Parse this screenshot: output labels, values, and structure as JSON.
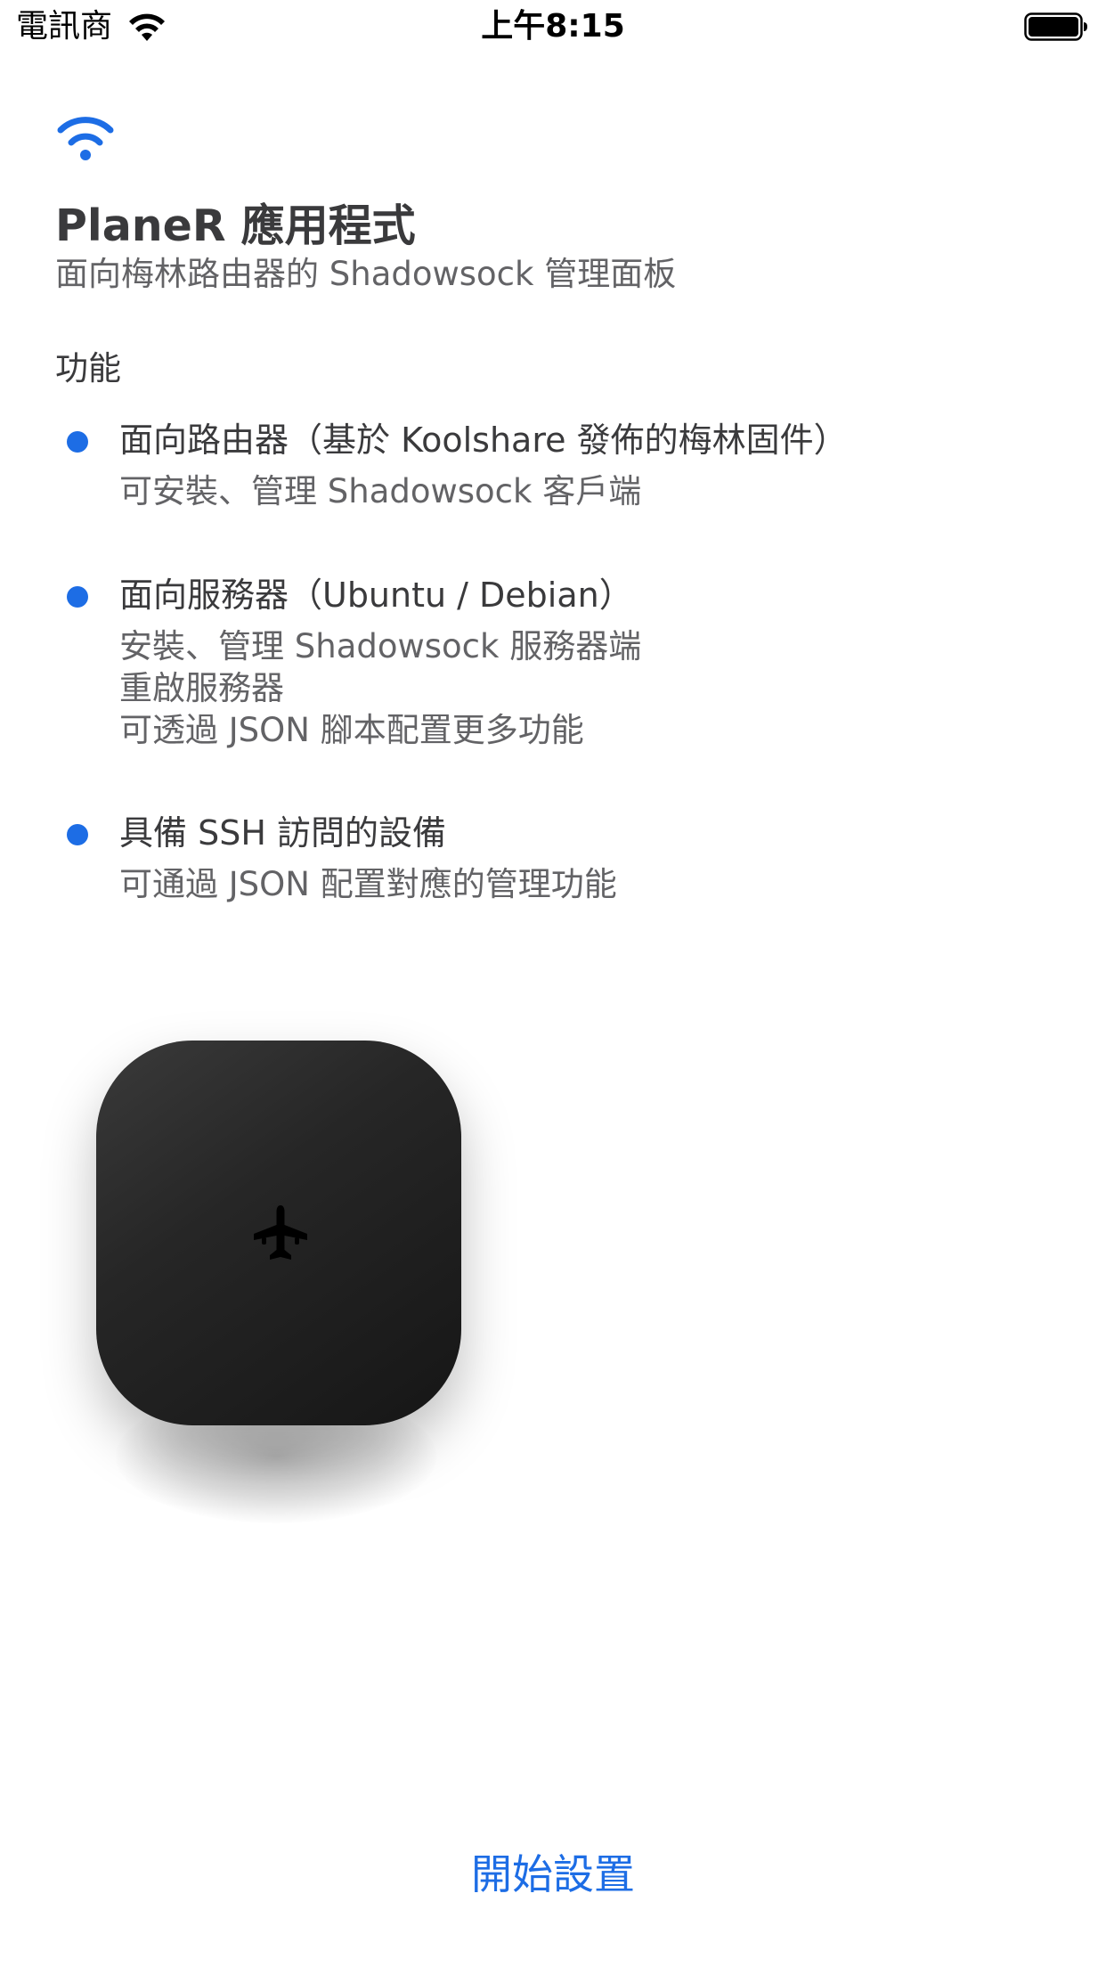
{
  "status_bar": {
    "carrier": "電訊商",
    "time": "上午8:15",
    "wifi_icon": "wifi-icon",
    "battery_icon": "battery-full-icon"
  },
  "header": {
    "icon": "wifi-icon",
    "title": "PlaneR 應用程式",
    "subtitle": "面向梅林路由器的 Shadowsock 管理面板"
  },
  "features": {
    "section_title": "功能",
    "items": [
      {
        "title": "面向路由器（基於 Koolshare 發佈的梅林固件）",
        "lines": [
          "可安裝、管理 Shadowsock 客戶端"
        ]
      },
      {
        "title": "面向服務器（Ubuntu / Debian）",
        "lines": [
          "安裝、管理 Shadowsock 服務器端",
          "重啟服務器",
          "可透過 JSON 腳本配置更多功能"
        ]
      },
      {
        "title": "具備 SSH 訪問的設備",
        "lines": [
          "可通過 JSON 配置對應的管理功能"
        ]
      }
    ]
  },
  "illustration": {
    "device": "router-device-image",
    "logo": "airplane-icon"
  },
  "actions": {
    "start_label": "開始設置"
  },
  "colors": {
    "accent": "#1d6de5",
    "title_text": "#3a3a3c",
    "secondary_text": "#636366"
  }
}
